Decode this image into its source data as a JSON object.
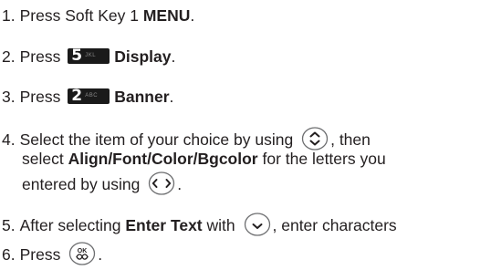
{
  "steps": [
    {
      "num": "1.",
      "pre": "Press Soft Key 1 ",
      "bold": "MENU",
      "post": "."
    },
    {
      "num": "2.",
      "pre": "Press",
      "key_digit": "5",
      "key_letters": "JKL",
      "bold": "Display",
      "post": "."
    },
    {
      "num": "3.",
      "pre": "Press",
      "key_digit": "2",
      "key_letters": "ABC",
      "bold": "Banner",
      "post": "."
    },
    {
      "num": "4.",
      "line1_pre": "Select the item of your choice by using",
      "line1_post": ", then",
      "line2_pre": "select ",
      "line2_bold": "Align/Font/Color/Bgcolor",
      "line2_post": " for the letters you",
      "line3_pre": "entered by using",
      "line3_post": "."
    },
    {
      "num": "5.",
      "pre": "After selecting ",
      "bold": "Enter Text",
      "mid": " with",
      "post": ", enter characters"
    },
    {
      "num": "6.",
      "pre": "Press",
      "post": "."
    }
  ],
  "icons": {
    "updown": "navigation-up-down-icon",
    "leftright": "navigation-left-right-icon",
    "down": "navigation-down-icon",
    "ok": "ok-key-icon",
    "ok_label": "OK",
    "key_5": "keypad-5-jkl-icon",
    "key_2": "keypad-2-abc-icon"
  }
}
